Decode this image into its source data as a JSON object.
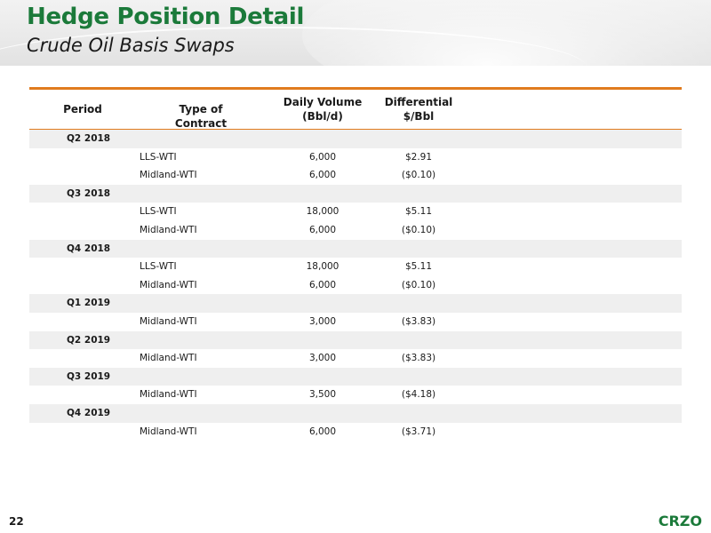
{
  "slide": {
    "title": "Hedge Position Detail",
    "subtitle": "Crude Oil Basis Swaps",
    "page_number": "22",
    "logo": "CRZO"
  },
  "table": {
    "headers": {
      "period": "Period",
      "type": "Type of Contract",
      "volume_line1": "Daily Volume",
      "volume_line2": "(Bbl/d)",
      "diff_line1": "Differential",
      "diff_line2": "$/Bbl"
    },
    "groups": [
      {
        "period": "Q2 2018",
        "rows": [
          {
            "type": "LLS-WTI",
            "volume": "6,000",
            "differential": "$2.91"
          },
          {
            "type": "Midland-WTI",
            "volume": "6,000",
            "differential": "($0.10)"
          }
        ]
      },
      {
        "period": "Q3 2018",
        "rows": [
          {
            "type": "LLS-WTI",
            "volume": "18,000",
            "differential": "$5.11"
          },
          {
            "type": "Midland-WTI",
            "volume": "6,000",
            "differential": "($0.10)"
          }
        ]
      },
      {
        "period": "Q4 2018",
        "rows": [
          {
            "type": "LLS-WTI",
            "volume": "18,000",
            "differential": "$5.11"
          },
          {
            "type": "Midland-WTI",
            "volume": "6,000",
            "differential": "($0.10)"
          }
        ]
      },
      {
        "period": "Q1 2019",
        "rows": [
          {
            "type": "Midland-WTI",
            "volume": "3,000",
            "differential": "($3.83)"
          }
        ]
      },
      {
        "period": "Q2 2019",
        "rows": [
          {
            "type": "Midland-WTI",
            "volume": "3,000",
            "differential": "($3.83)"
          }
        ]
      },
      {
        "period": "Q3 2019",
        "rows": [
          {
            "type": "Midland-WTI",
            "volume": "3,500",
            "differential": "($4.18)"
          }
        ]
      },
      {
        "period": "Q4 2019",
        "rows": [
          {
            "type": "Midland-WTI",
            "volume": "6,000",
            "differential": "($3.71)"
          }
        ]
      }
    ]
  },
  "colors": {
    "brand_green": "#1b7a3a",
    "rule_orange": "#e07b1e",
    "period_row_bg": "#efefef"
  }
}
